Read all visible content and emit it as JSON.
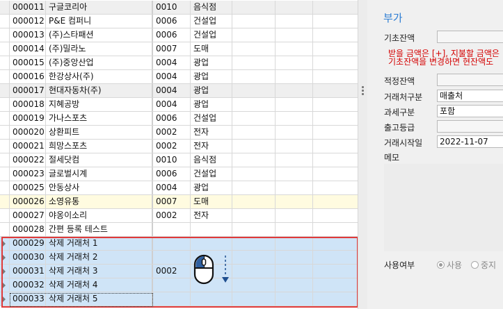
{
  "grid": {
    "rows": [
      {
        "code": "000011",
        "name": "구글코리아",
        "industry_code": "0010",
        "industry": "음식점",
        "style": "gray",
        "marker": false
      },
      {
        "code": "000012",
        "name": "P&E 컴퍼니",
        "industry_code": "0006",
        "industry": "건설업",
        "style": "",
        "marker": false
      },
      {
        "code": "000013",
        "name": "(주)스타패션",
        "industry_code": "0006",
        "industry": "건설업",
        "style": "",
        "marker": false
      },
      {
        "code": "000014",
        "name": "(주)밀라노",
        "industry_code": "0007",
        "industry": "도매",
        "style": "",
        "marker": false
      },
      {
        "code": "000015",
        "name": "(주)중앙산업",
        "industry_code": "0004",
        "industry": "광업",
        "style": "",
        "marker": false
      },
      {
        "code": "000016",
        "name": "한강상사(주)",
        "industry_code": "0004",
        "industry": "광업",
        "style": "",
        "marker": false
      },
      {
        "code": "000017",
        "name": "현대자동차(주)",
        "industry_code": "0004",
        "industry": "광업",
        "style": "gray",
        "marker": false
      },
      {
        "code": "000018",
        "name": "지혜공방",
        "industry_code": "0004",
        "industry": "광업",
        "style": "",
        "marker": false
      },
      {
        "code": "000019",
        "name": "가나스포츠",
        "industry_code": "0006",
        "industry": "건설업",
        "style": "",
        "marker": false
      },
      {
        "code": "000020",
        "name": "상환피트",
        "industry_code": "0002",
        "industry": "전자",
        "style": "",
        "marker": false
      },
      {
        "code": "000021",
        "name": "희망스포츠",
        "industry_code": "0002",
        "industry": "전자",
        "style": "",
        "marker": false
      },
      {
        "code": "000022",
        "name": "절세닷컴",
        "industry_code": "0010",
        "industry": "음식점",
        "style": "",
        "marker": false
      },
      {
        "code": "000023",
        "name": "글로벌시계",
        "industry_code": "0006",
        "industry": "건설업",
        "style": "",
        "marker": false
      },
      {
        "code": "000025",
        "name": "안동상사",
        "industry_code": "0004",
        "industry": "광업",
        "style": "",
        "marker": false
      },
      {
        "code": "000026",
        "name": "소영유통",
        "industry_code": "0007",
        "industry": "도매",
        "style": "yellow",
        "marker": false
      },
      {
        "code": "000027",
        "name": "야옹이소리",
        "industry_code": "0002",
        "industry": "전자",
        "style": "",
        "marker": false
      },
      {
        "code": "000028",
        "name": "간편 등록 테스트",
        "industry_code": "",
        "industry": "",
        "style": "",
        "marker": false
      },
      {
        "code": "000029",
        "name": "삭제 거래처 1",
        "industry_code": "",
        "industry": "",
        "style": "blue",
        "marker": true
      },
      {
        "code": "000030",
        "name": "삭제 거래처 2",
        "industry_code": "",
        "industry": "",
        "style": "blue",
        "marker": true
      },
      {
        "code": "000031",
        "name": "삭제 거래처 3",
        "industry_code": "0002",
        "industry": "",
        "style": "blue",
        "marker": true
      },
      {
        "code": "000032",
        "name": "삭제 거래처 4",
        "industry_code": "",
        "industry": "",
        "style": "blue",
        "marker": true
      },
      {
        "code": "000033",
        "name": "삭제 거래처 5",
        "industry_code": "",
        "industry": "",
        "style": "blue",
        "marker": true
      }
    ]
  },
  "panel": {
    "title": "부가",
    "opening_balance_label": "기초잔액",
    "opening_balance_value": "",
    "note_line1": "받을 금액은 [+], 지불할 금액은",
    "note_line2": "기초잔액을 변경하면 현잔액도",
    "proper_balance_label": "적정잔액",
    "proper_balance_value": "",
    "trade_type_label": "거래처구분",
    "trade_type_value": "매출처",
    "tax_type_label": "과세구분",
    "tax_type_value": "포함",
    "ship_grade_label": "출고등급",
    "ship_grade_value": "",
    "trade_start_label": "거래시작일",
    "trade_start_value": "2022-11-07",
    "memo_label": "메모",
    "usage_label": "사용여부",
    "use_option": "사용",
    "stop_option": "중지"
  },
  "colors": {
    "selection_border": "#e03a3a",
    "selected_row": "#cfe4f7",
    "title_blue": "#2b7cd3",
    "note_red": "#d40000"
  }
}
